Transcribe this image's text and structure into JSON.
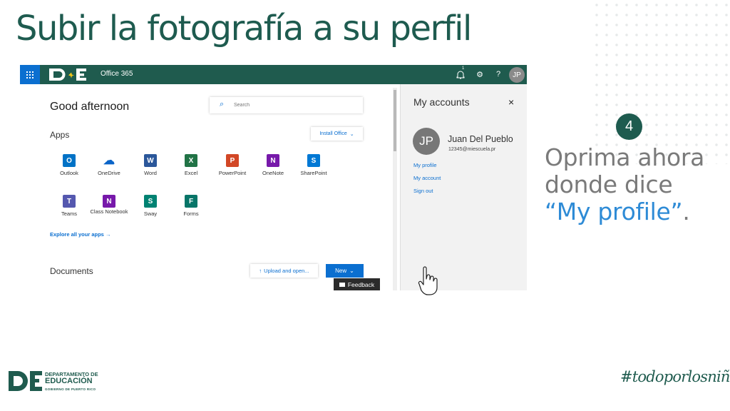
{
  "slide": {
    "title": "Subir la fotografía a su perfil",
    "step_number": "4",
    "instruction_lines": [
      "Oprima ahora",
      "donde dice"
    ],
    "instruction_highlight": "“My profile”",
    "instruction_end": ".",
    "footer_logo": {
      "line1": "DEPARTAMENTO DE",
      "line2": "EDUCACIÓN",
      "line3": "GOBIERNO DE PUERTO RICO"
    },
    "hashtag": "#todoporlosniños"
  },
  "topbar": {
    "app_name": "Office 365",
    "notification_count": "1",
    "avatar_initials": "JP"
  },
  "main": {
    "greeting": "Good afternoon",
    "search_placeholder": "Search",
    "apps_heading": "Apps",
    "install_label": "Install Office",
    "apps": [
      {
        "label": "Outlook",
        "letter": "O",
        "color": "#0072c6"
      },
      {
        "label": "OneDrive",
        "letter": "☁",
        "color": "#0a64c8"
      },
      {
        "label": "Word",
        "letter": "W",
        "color": "#2b579a"
      },
      {
        "label": "Excel",
        "letter": "X",
        "color": "#217346"
      },
      {
        "label": "PowerPoint",
        "letter": "P",
        "color": "#d24726"
      },
      {
        "label": "OneNote",
        "letter": "N",
        "color": "#7719aa"
      },
      {
        "label": "SharePoint",
        "letter": "S",
        "color": "#0078d4"
      },
      {
        "label": "Teams",
        "letter": "T",
        "color": "#5558af"
      },
      {
        "label": "Class Notebook",
        "letter": "N",
        "color": "#7719aa"
      },
      {
        "label": "Sway",
        "letter": "S",
        "color": "#008272"
      },
      {
        "label": "Forms",
        "letter": "F",
        "color": "#077568"
      }
    ],
    "explore_label": "Explore all your apps",
    "documents_heading": "Documents",
    "upload_label": "Upload and open...",
    "new_label": "New",
    "feedback_label": "Feedback"
  },
  "accounts_panel": {
    "title": "My accounts",
    "avatar_initials": "JP",
    "name": "Juan Del Pueblo",
    "email": "12345@miescuela.pr",
    "links": {
      "my_profile": "My profile",
      "my_account": "My account",
      "sign_out": "Sign out"
    }
  },
  "colors": {
    "brand_green": "#1f5b4e",
    "office_blue": "#0b6fd0",
    "highlight_blue": "#2e8bd6"
  }
}
